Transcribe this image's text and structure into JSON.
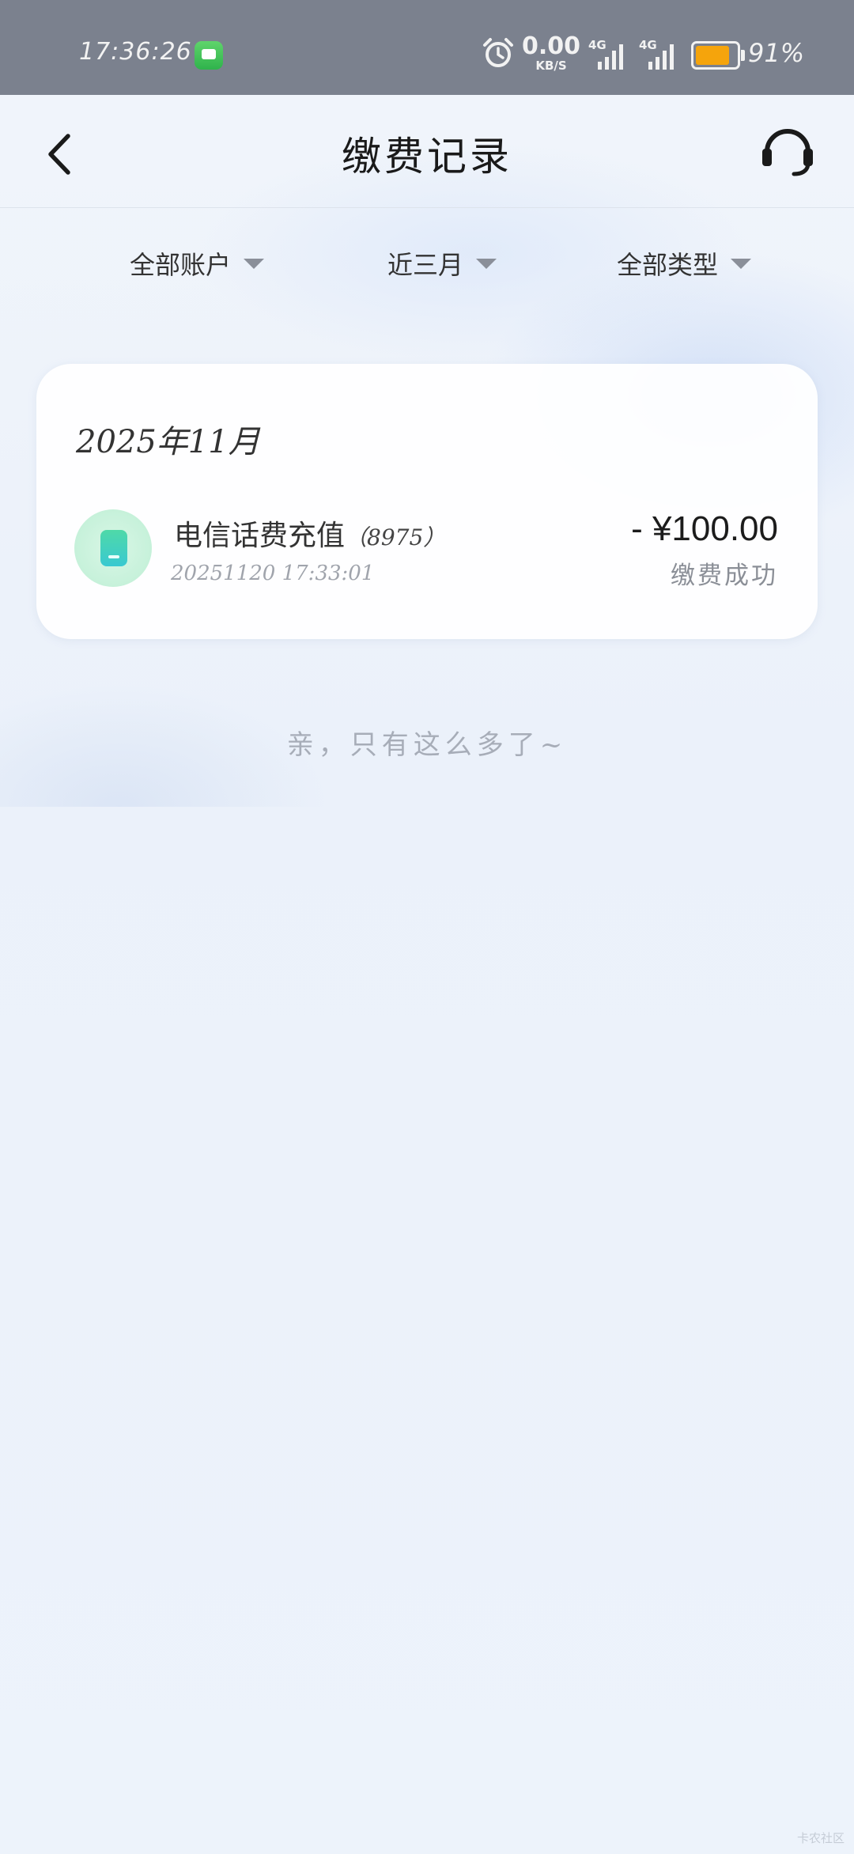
{
  "status_bar": {
    "time": "17:36:26",
    "speed_value": "0.00",
    "speed_unit": "KB/S",
    "signal1_label": "4G",
    "signal2_label": "4G",
    "battery_percent": "91%",
    "battery_level": 0.91,
    "battery_color": "#f5a40c"
  },
  "header": {
    "title": "缴费记录",
    "back_icon": "chevron-left-icon",
    "service_icon": "headset-icon"
  },
  "filters": {
    "account": "全部账户",
    "period": "近三月",
    "type": "全部类型"
  },
  "records": {
    "month": "2025年11月",
    "items": [
      {
        "icon": "phone-icon",
        "title": "电信话费充值",
        "account": "（8975）",
        "datetime": "20251120  17:33:01",
        "amount": "- ¥100.00",
        "status": "缴费成功"
      }
    ]
  },
  "end_tip": "亲，只有这么多了~",
  "watermark": "卡农社区"
}
